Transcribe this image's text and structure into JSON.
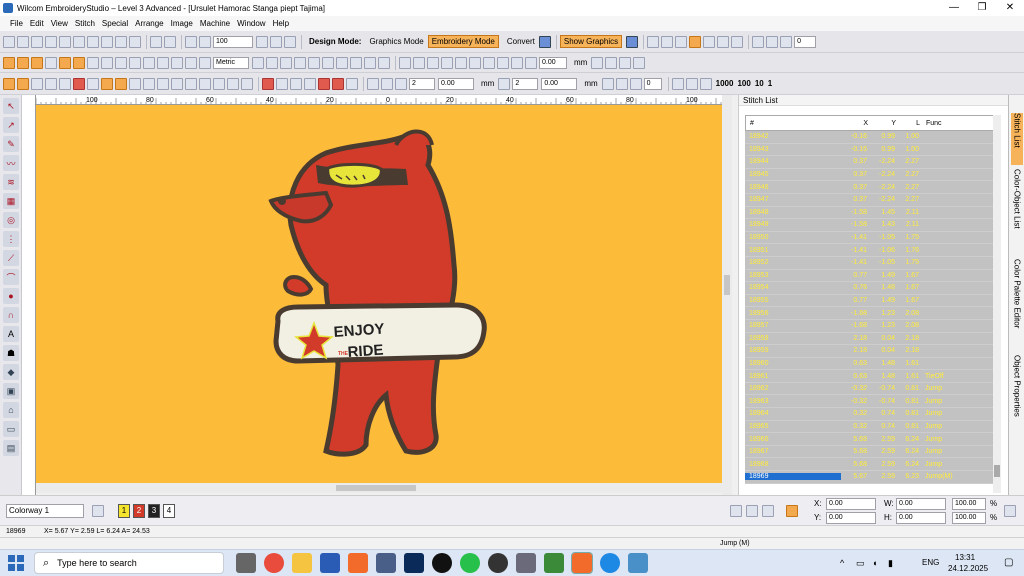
{
  "window": {
    "title": "Wilcom EmbroideryStudio – Level 3 Advanced - [Ursulet Hamorac Stanga piept          Tajima]",
    "controls": [
      "—",
      "❐",
      "✕"
    ]
  },
  "menu": [
    "File",
    "Edit",
    "View",
    "Stitch",
    "Special",
    "Arrange",
    "Image",
    "Machine",
    "Window",
    "Help"
  ],
  "toolbar1": {
    "zoom_value": "100",
    "design_mode_label": "Design Mode:",
    "graphics_mode": "Graphics Mode",
    "embroidery_mode": "Embroidery Mode",
    "convert": "Convert",
    "show_graphics": "Show Graphics",
    "right_value": "0"
  },
  "toolbar2": {
    "units": "Metric",
    "value": "0.00",
    "unit_mm": "mm"
  },
  "toolbar3": {
    "v1": "2",
    "v2": "0.00",
    "unit1": "mm",
    "v3": "2",
    "v4": "0.00",
    "unit2": "mm",
    "v5": "0",
    "n1000": "1000",
    "n100": "100",
    "n10": "10",
    "n1": "1"
  },
  "ruler_top_ticks": [
    "100",
    "80",
    "60",
    "40",
    "20",
    "0",
    "20",
    "40",
    "60",
    "80",
    "100"
  ],
  "stitch_list": {
    "title": "Stitch List",
    "columns": [
      "#",
      "X",
      "Y",
      "L",
      "Func"
    ],
    "rows": [
      [
        "18942",
        "-0.16",
        "0.99",
        "1.00",
        ""
      ],
      [
        "18943",
        "-0.16",
        "0.99",
        "1.00",
        ""
      ],
      [
        "18944",
        "0.37",
        "-2.24",
        "2.27",
        ""
      ],
      [
        "18945",
        "0.37",
        "-2.24",
        "2.27",
        ""
      ],
      [
        "18946",
        "0.37",
        "-2.24",
        "2.27",
        ""
      ],
      [
        "18947",
        "0.37",
        "-2.24",
        "2.27",
        ""
      ],
      [
        "18948",
        "-1.58",
        "1.45",
        "2.11",
        ""
      ],
      [
        "18949",
        "-1.58",
        "1.43",
        "2.11",
        ""
      ],
      [
        "18950",
        "-1.41",
        "-1.05",
        "1.75",
        ""
      ],
      [
        "18951",
        "-1.41",
        "-1.06",
        "1.76",
        ""
      ],
      [
        "18952",
        "-1.41",
        "-1.05",
        "1.75",
        ""
      ],
      [
        "18953",
        "0.77",
        "1.49",
        "1.67",
        ""
      ],
      [
        "18954",
        "0.76",
        "1.48",
        "1.67",
        ""
      ],
      [
        "18955",
        "0.77",
        "1.49",
        "1.67",
        ""
      ],
      [
        "18956",
        "-1.68",
        "1.23",
        "2.08",
        ""
      ],
      [
        "18957",
        "-1.68",
        "1.23",
        "2.08",
        ""
      ],
      [
        "18958",
        "2.18",
        "0.04",
        "2.18",
        ""
      ],
      [
        "18959",
        "2.18",
        "0.04",
        "2.18",
        ""
      ],
      [
        "18960",
        "0.63",
        "1.48",
        "1.61",
        ""
      ],
      [
        "18961",
        "0.63",
        "1.48",
        "1.61",
        "TieOff"
      ],
      [
        "18962",
        "-0.32",
        "-0.74",
        "0.81",
        "Jump"
      ],
      [
        "18963",
        "-0.32",
        "-0.74",
        "0.81",
        "Jump"
      ],
      [
        "18964",
        "0.32",
        "0.74",
        "0.81",
        "Jump"
      ],
      [
        "18965",
        "0.32",
        "0.74",
        "0.81",
        "Jump"
      ],
      [
        "18966",
        "5.68",
        "2.59",
        "6.24",
        "Jump"
      ],
      [
        "18967",
        "5.68",
        "2.59",
        "6.24",
        "Jump"
      ],
      [
        "18968",
        "5.68",
        "2.59",
        "6.24",
        "Jump"
      ],
      [
        "18969",
        "5.67",
        "2.59",
        "6.23",
        "Jump(M)"
      ]
    ],
    "selected_index": 27
  },
  "right_tabs": [
    "Stitch List",
    "Color-Object List",
    "Color Palette Editor",
    "Object Properties"
  ],
  "bottombar": {
    "colorway": "Colorway 1",
    "swatches": [
      "1",
      "2",
      "3",
      "4"
    ],
    "x_label": "X:",
    "x_val": "0.00",
    "y_label": "Y:",
    "y_val": "0.00",
    "w_label": "W:",
    "w_val": "0.00",
    "h_label": "H:",
    "h_val": "0.00",
    "w_pct": "100.00",
    "h_pct": "100.00",
    "pct": "%"
  },
  "status": {
    "stitch_no": "18969",
    "coords": "X=   5.67 Y=   2.59 L=   6.24 A=  24.53",
    "func": "Jump (M)"
  },
  "design": {
    "board_text_line1": "ENJOY",
    "board_text_line2": "RIDE",
    "board_text_small": "THE"
  },
  "taskbar": {
    "search_placeholder": "Type here to search",
    "lang": "ENG",
    "time": "13:31",
    "date": "24.12.2025"
  },
  "colors": {
    "canvas": "#fcbb39",
    "bear": "#d23a2a",
    "outline": "#4a3b30",
    "goggles": "#e7e43a",
    "board": "#f2efe3",
    "accent": "#f7b35a"
  }
}
